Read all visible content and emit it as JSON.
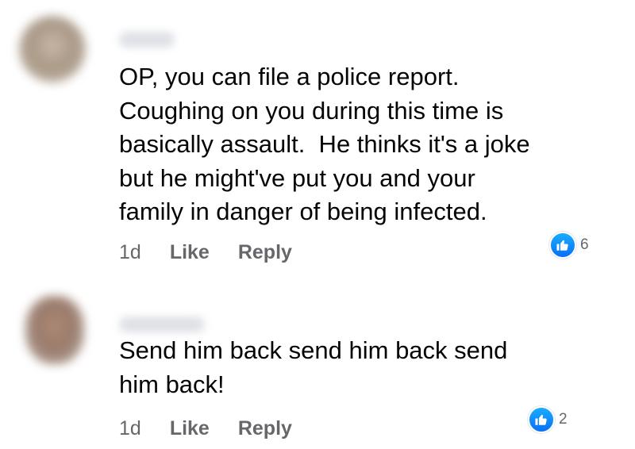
{
  "comments": [
    {
      "text": "OP, you can file a police report.\nCoughing on you during this time is\nbasically assault.  He thinks it's a joke\nbut he might've put you and your\nfamily in danger of being infected.",
      "time": "1d",
      "like_label": "Like",
      "reply_label": "Reply",
      "reaction_count": "6",
      "reaction_icon": "thumbs-up-icon"
    },
    {
      "text": "Send him back send him back send\nhim back!",
      "time": "1d",
      "like_label": "Like",
      "reply_label": "Reply",
      "reaction_count": "2",
      "reaction_icon": "thumbs-up-icon"
    }
  ],
  "colors": {
    "text": "#050505",
    "secondary": "#65676b",
    "like_blue": "#0a6ef5"
  }
}
